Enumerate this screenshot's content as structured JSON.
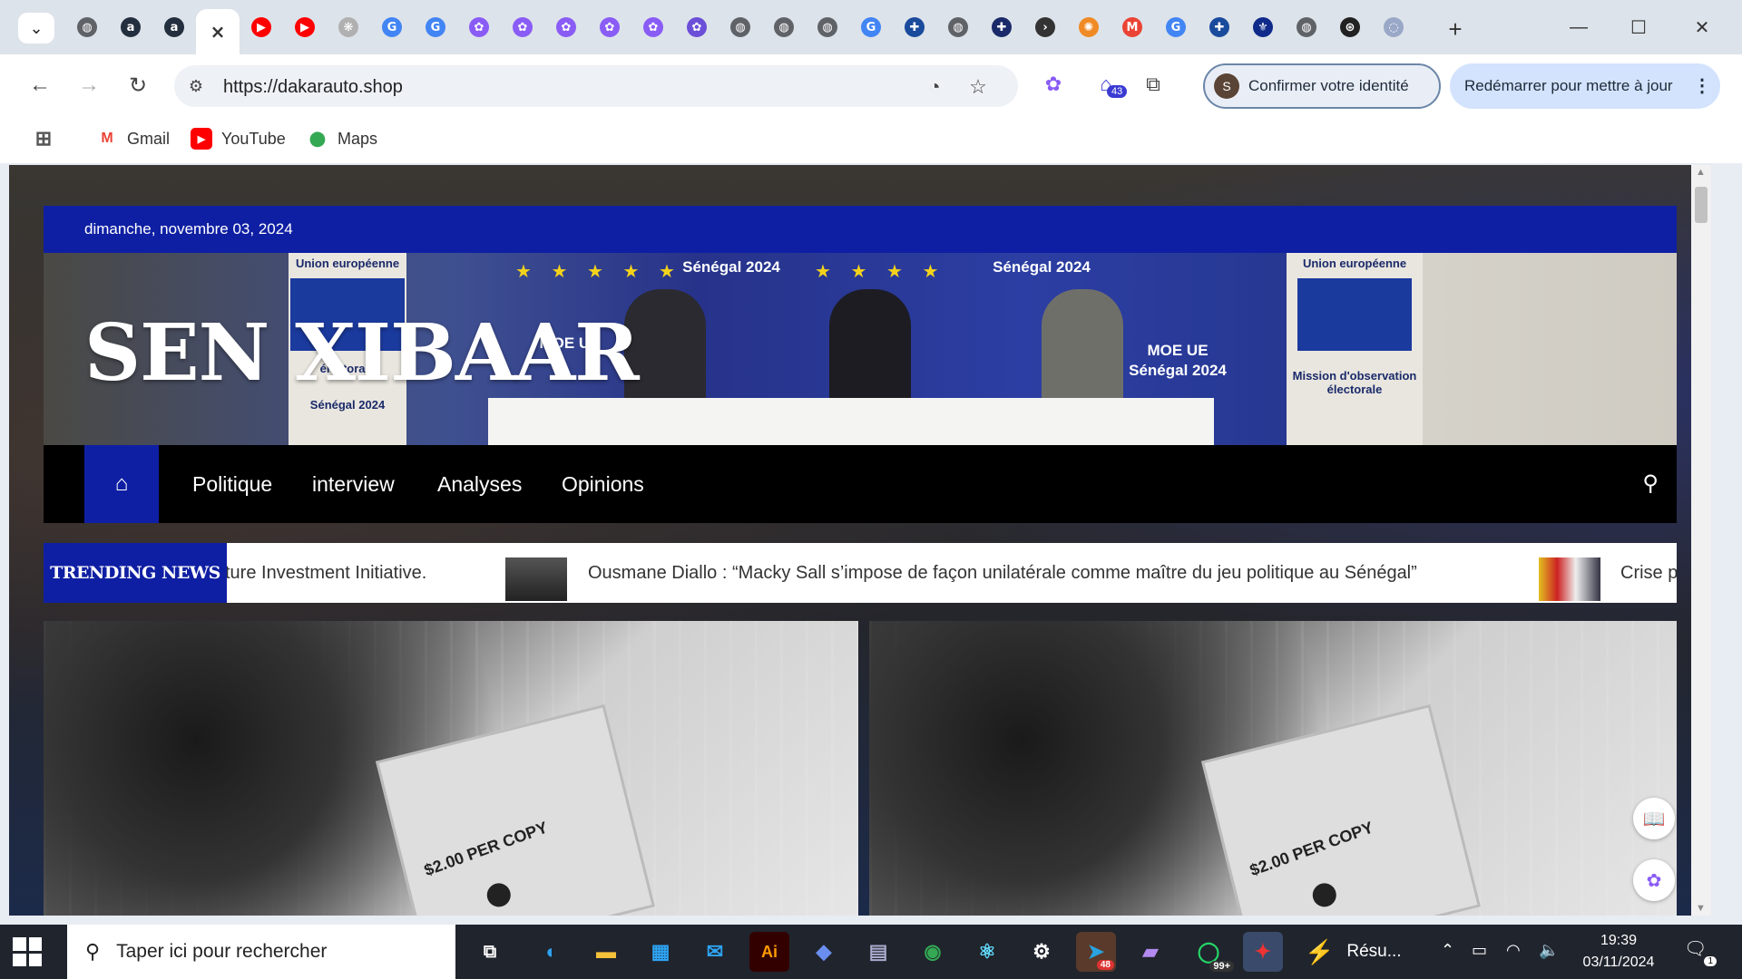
{
  "browser": {
    "active_tab_close": "×",
    "tabs": [
      {
        "icon": "globe-icon",
        "color": "#5f6368"
      },
      {
        "icon": "amazon-icon",
        "color": "#232f3e"
      },
      {
        "icon": "amazon-icon",
        "color": "#232f3e"
      },
      {
        "icon": "close-icon",
        "color": "#333333",
        "active": true
      },
      {
        "icon": "youtube-icon",
        "color": "#ff0000"
      },
      {
        "icon": "youtube-icon",
        "color": "#ff0000"
      },
      {
        "icon": "brain-icon",
        "color": "#b0b0b0"
      },
      {
        "icon": "google-icon",
        "color": "#4285f4"
      },
      {
        "icon": "google-icon",
        "color": "#4285f4"
      },
      {
        "icon": "copilot-icon",
        "color": "#8a5cf6"
      },
      {
        "icon": "copilot-icon",
        "color": "#8a5cf6"
      },
      {
        "icon": "copilot-icon",
        "color": "#8a5cf6"
      },
      {
        "icon": "copilot-icon",
        "color": "#8a5cf6"
      },
      {
        "icon": "copilot-icon",
        "color": "#8a5cf6"
      },
      {
        "icon": "copilot-icon",
        "color": "#6b4fd8"
      },
      {
        "icon": "globe-icon",
        "color": "#5f6368"
      },
      {
        "icon": "globe-icon",
        "color": "#5f6368"
      },
      {
        "icon": "globe-icon",
        "color": "#5f6368"
      },
      {
        "icon": "google-icon",
        "color": "#4285f4"
      },
      {
        "icon": "quebec-icon",
        "color": "#1a4a9c"
      },
      {
        "icon": "globe-icon",
        "color": "#5f6368"
      },
      {
        "icon": "plus-circle-icon",
        "color": "#1a2a6a"
      },
      {
        "icon": "arrow-icon",
        "color": "#333333"
      },
      {
        "icon": "star-badge-icon",
        "color": "#f08a24"
      },
      {
        "icon": "gmail-icon",
        "color": "#ea4335"
      },
      {
        "icon": "google-icon",
        "color": "#4285f4"
      },
      {
        "icon": "quebec-icon",
        "color": "#1a4a9c"
      },
      {
        "icon": "fleur-de-lis-icon",
        "color": "#0f2a8a"
      },
      {
        "icon": "globe-icon",
        "color": "#5f6368"
      },
      {
        "icon": "openai-icon",
        "color": "#222222"
      },
      {
        "icon": "loading-icon",
        "color": "#9aa8c8"
      }
    ],
    "url": "https://dakarauto.shop",
    "extension_badge": "43",
    "profile_button": "Confirmer votre identité",
    "profile_initial": "S",
    "update_button": "Redémarrer pour mettre à jour",
    "bookmarks": [
      {
        "label": "Gmail",
        "icon": "gmail-icon"
      },
      {
        "label": "YouTube",
        "icon": "youtube-icon"
      },
      {
        "label": "Maps",
        "icon": "maps-pin-icon"
      }
    ]
  },
  "page": {
    "date": "dimanche, novembre 03, 2024",
    "site_title": "SEN XIBAAR",
    "hero_signs": {
      "union": "Union européenne",
      "senegal": "Sénégal 2024",
      "moe": "MOE UE",
      "moe_sub": "Sénégal 2024",
      "mission": "Mission d'observation électorale",
      "electorale": "électorale",
      "senegal_short": "Sénégal 2024"
    },
    "nav": {
      "home_icon": "home-icon",
      "items": [
        "Politique",
        "interview",
        "Analyses",
        "Opinions"
      ],
      "search_icon": "search-icon"
    },
    "ticker": {
      "label": "TRENDING NEWS",
      "items": [
        "ture Investment Initiative.",
        "Ousmane Diallo : “Macky Sall s’impose de façon unilatérale comme maître du jeu politique au Sénégal”",
        "Crise p"
      ]
    },
    "card_price": "$2.00 PER COPY"
  },
  "taskbar": {
    "search_placeholder": "Taper ici pour rechercher",
    "telegram_badge": "48",
    "whatsapp_badge": "99+",
    "resume_label": "Résu...",
    "time": "19:39",
    "date": "03/11/2024",
    "notifications": "1"
  },
  "colors": {
    "brand_blue": "#0f1fa3",
    "nav_black": "#000000",
    "tabstrip": "#dde3ea"
  }
}
